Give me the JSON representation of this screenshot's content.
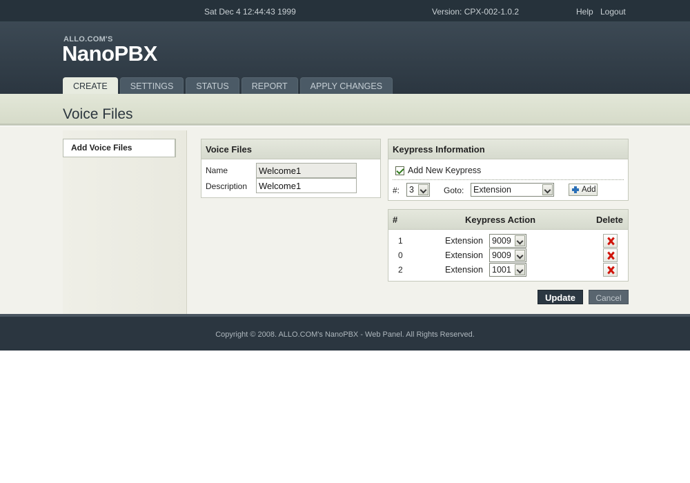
{
  "topbar": {
    "datetime": "Sat Dec 4 12:44:43 1999",
    "version": "Version: CPX-002-1.0.2",
    "help": "Help",
    "logout": "Logout"
  },
  "brand": {
    "small": "ALLO.COM'S",
    "name": "NanoPBX"
  },
  "tabs": [
    {
      "label": "CREATE",
      "active": true
    },
    {
      "label": "SETTINGS",
      "active": false
    },
    {
      "label": "STATUS",
      "active": false
    },
    {
      "label": "REPORT",
      "active": false
    },
    {
      "label": "APPLY CHANGES",
      "active": false
    }
  ],
  "page_title": "Voice Files",
  "sidebar": {
    "items": [
      {
        "label": "Add Voice Files"
      }
    ]
  },
  "voice_files": {
    "title": "Voice Files",
    "name_label": "Name",
    "name_value": "Welcome1",
    "description_label": "Description",
    "description_value": "Welcome1"
  },
  "keypress_info": {
    "title": "Keypress Information",
    "add_new_label": "Add New Keypress",
    "add_new_checked": true,
    "hash_label": "#:",
    "hash_value": "3",
    "goto_label": "Goto:",
    "goto_value": "Extension",
    "add_button": "Add"
  },
  "keypress_table": {
    "headers": {
      "hash": "#",
      "action": "Keypress Action",
      "delete": "Delete"
    },
    "rows": [
      {
        "key": "1",
        "type": "Extension",
        "value": "9009"
      },
      {
        "key": "0",
        "type": "Extension",
        "value": "9009"
      },
      {
        "key": "2",
        "type": "Extension",
        "value": "1001"
      }
    ]
  },
  "buttons": {
    "update": "Update",
    "cancel": "Cancel"
  },
  "footer": {
    "copyright": "Copyright © 2008. ALLO.COM's NanoPBX - Web Panel. All Rights Reserved."
  },
  "icons": {
    "add": "plus-icon",
    "delete": "delete-x-icon",
    "dropdown": "chevron-down-icon",
    "checkbox": "checkmark-icon"
  },
  "colors": {
    "header_dark": "#2b3640",
    "active_tab": "#e7ebdf",
    "delete_red": "#d0150c",
    "add_blue": "#2a6fb7"
  }
}
